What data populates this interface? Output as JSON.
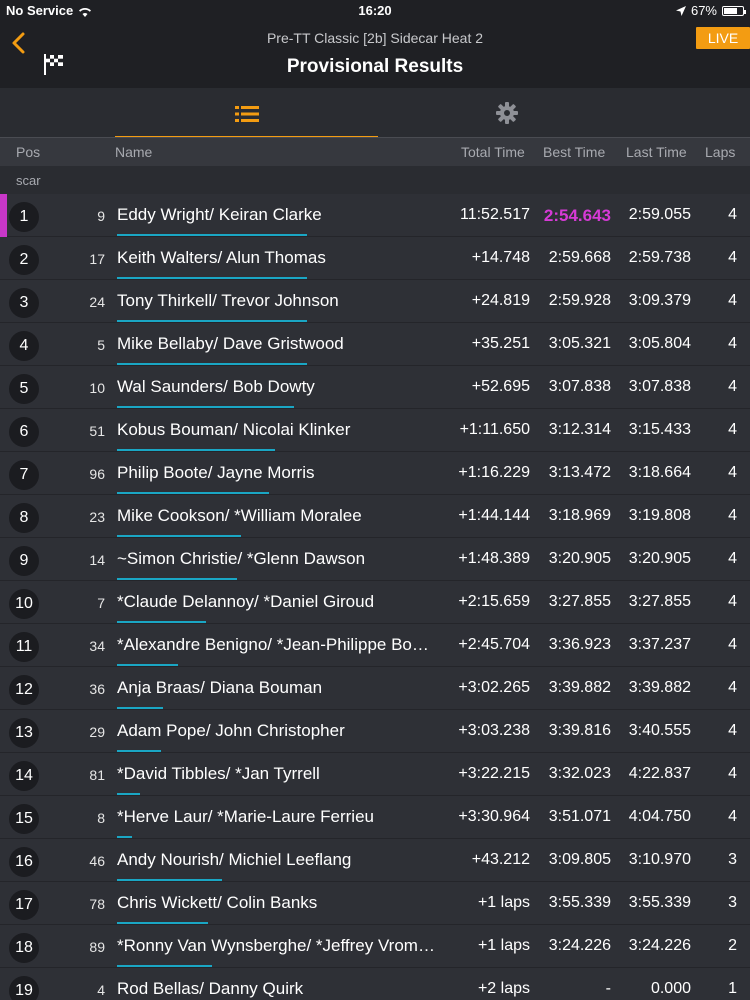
{
  "status_bar": {
    "carrier": "No Service",
    "time": "16:20",
    "battery": "67%"
  },
  "header": {
    "subtitle": "Pre-TT Classic [2b] Sidecar Heat 2",
    "title": "Provisional Results",
    "live_label": "LIVE"
  },
  "columns": {
    "pos": "Pos",
    "name": "Name",
    "total": "Total Time",
    "best": "Best Time",
    "last": "Last Time",
    "laps": "Laps"
  },
  "group_label": "scar",
  "colors": {
    "accent": "#f39c12",
    "fastest": "#d63ad6",
    "progress": "#1aa6c4"
  },
  "rows": [
    {
      "pos": "1",
      "num": "9",
      "name": "Eddy Wright/ Keiran Clarke",
      "total": "11:52.517",
      "best": "2:54.643",
      "last": "2:59.055",
      "laps": "4",
      "progress": 1.0
    },
    {
      "pos": "2",
      "num": "17",
      "name": "Keith Walters/ Alun  Thomas",
      "total": "+14.748",
      "best": "2:59.668",
      "last": "2:59.738",
      "laps": "4",
      "progress": 1.0
    },
    {
      "pos": "3",
      "num": "24",
      "name": "Tony Thirkell/ Trevor  Johnson",
      "total": "+24.819",
      "best": "2:59.928",
      "last": "3:09.379",
      "laps": "4",
      "progress": 1.0
    },
    {
      "pos": "4",
      "num": "5",
      "name": "Mike Bellaby/ Dave Gristwood",
      "total": "+35.251",
      "best": "3:05.321",
      "last": "3:05.804",
      "laps": "4",
      "progress": 1.0
    },
    {
      "pos": "5",
      "num": "10",
      "name": "Wal Saunders/ Bob Dowty",
      "total": "+52.695",
      "best": "3:07.838",
      "last": "3:07.838",
      "laps": "4",
      "progress": 0.93
    },
    {
      "pos": "6",
      "num": "51",
      "name": "Kobus Bouman/ Nicolai Klinker",
      "total": "+1:11.650",
      "best": "3:12.314",
      "last": "3:15.433",
      "laps": "4",
      "progress": 0.83
    },
    {
      "pos": "7",
      "num": "96",
      "name": "Philip Boote/ Jayne Morris",
      "total": "+1:16.229",
      "best": "3:13.472",
      "last": "3:18.664",
      "laps": "4",
      "progress": 0.8
    },
    {
      "pos": "8",
      "num": "23",
      "name": "Mike Cookson/ *William Moralee",
      "total": "+1:44.144",
      "best": "3:18.969",
      "last": "3:19.808",
      "laps": "4",
      "progress": 0.65
    },
    {
      "pos": "9",
      "num": "14",
      "name": "~Simon Christie/ *Glenn Dawson",
      "total": "+1:48.389",
      "best": "3:20.905",
      "last": "3:20.905",
      "laps": "4",
      "progress": 0.63
    },
    {
      "pos": "10",
      "num": "7",
      "name": "*Claude Delannoy/ *Daniel Giroud",
      "total": "+2:15.659",
      "best": "3:27.855",
      "last": "3:27.855",
      "laps": "4",
      "progress": 0.47
    },
    {
      "pos": "11",
      "num": "34",
      "name": "*Alexandre Benigno/ *Jean-Philippe Bo…",
      "total": "+2:45.704",
      "best": "3:36.923",
      "last": "3:37.237",
      "laps": "4",
      "progress": 0.32
    },
    {
      "pos": "12",
      "num": "36",
      "name": "Anja Braas/ Diana Bouman",
      "total": "+3:02.265",
      "best": "3:39.882",
      "last": "3:39.882",
      "laps": "4",
      "progress": 0.24
    },
    {
      "pos": "13",
      "num": "29",
      "name": "Adam Pope/ John Christopher",
      "total": "+3:03.238",
      "best": "3:39.816",
      "last": "3:40.555",
      "laps": "4",
      "progress": 0.23
    },
    {
      "pos": "14",
      "num": "81",
      "name": "*David Tibbles/ *Jan Tyrrell",
      "total": "+3:22.215",
      "best": "3:32.023",
      "last": "4:22.837",
      "laps": "4",
      "progress": 0.12
    },
    {
      "pos": "15",
      "num": "8",
      "name": "*Herve Laur/ *Marie-Laure Ferrieu",
      "total": "+3:30.964",
      "best": "3:51.071",
      "last": "4:04.750",
      "laps": "4",
      "progress": 0.08
    },
    {
      "pos": "16",
      "num": "46",
      "name": "Andy Nourish/ Michiel Leeflang",
      "total": "+43.212",
      "best": "3:09.805",
      "last": "3:10.970",
      "laps": "3",
      "progress": 0.55
    },
    {
      "pos": "17",
      "num": "78",
      "name": "Chris Wickett/ Colin Banks",
      "total": "+1 laps",
      "best": "3:55.339",
      "last": "3:55.339",
      "laps": "3",
      "progress": 0.48
    },
    {
      "pos": "18",
      "num": "89",
      "name": "*Ronny Van Wynsberghe/ *Jeffrey Vrom…",
      "total": "+1 laps",
      "best": "3:24.226",
      "last": "3:24.226",
      "laps": "2",
      "progress": 0.5
    },
    {
      "pos": "19",
      "num": "4",
      "name": "Rod Bellas/ Danny Quirk",
      "total": "+2 laps",
      "best": "-",
      "last": "0.000",
      "laps": "1",
      "progress": 0.0
    }
  ]
}
